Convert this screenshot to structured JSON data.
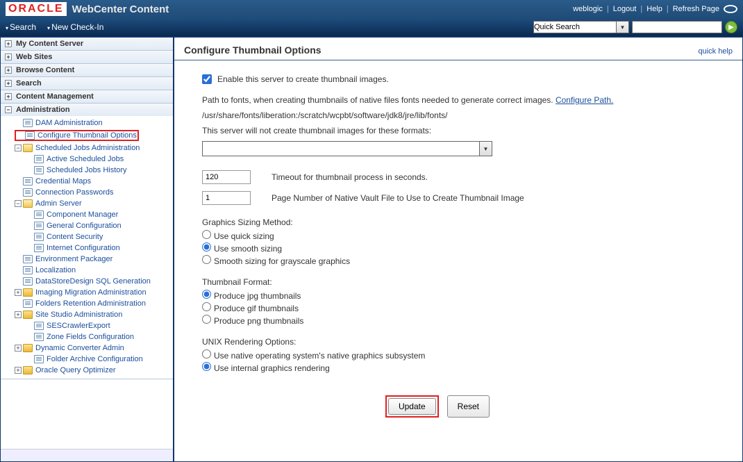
{
  "banner": {
    "logo": "ORACLE",
    "app_title": "WebCenter Content",
    "user": "weblogic",
    "logout": "Logout",
    "help": "Help",
    "refresh": "Refresh Page"
  },
  "menubar": {
    "search": "Search",
    "new_checkin": "New Check-In",
    "quick_search_placeholder": "Quick Search"
  },
  "sidebar": {
    "sections": {
      "my_content": "My Content Server",
      "web_sites": "Web Sites",
      "browse": "Browse Content",
      "search": "Search",
      "content_mgmt": "Content Management",
      "admin": "Administration"
    },
    "tree": {
      "dam_admin": "DAM Administration",
      "config_thumb": "Configure Thumbnail Options",
      "sched_jobs": "Scheduled Jobs Administration",
      "active_jobs": "Active Scheduled Jobs",
      "jobs_hist": "Scheduled Jobs History",
      "cred_maps": "Credential Maps",
      "conn_pw": "Connection Passwords",
      "admin_server": "Admin Server",
      "comp_mgr": "Component Manager",
      "gen_conf": "General Configuration",
      "cont_sec": "Content Security",
      "inet_conf": "Internet Configuration",
      "env_pack": "Environment Packager",
      "loc": "Localization",
      "dsd_sql": "DataStoreDesign SQL Generation",
      "img_mig": "Imaging Migration Administration",
      "fold_ret": "Folders Retention Administration",
      "site_studio": "Site Studio Administration",
      "ses_crawl": "SESCrawlerExport",
      "zone_fields": "Zone Fields Configuration",
      "dyn_conv": "Dynamic Converter Admin",
      "folder_arch": "Folder Archive Configuration",
      "oracle_qo": "Oracle Query Optimizer"
    }
  },
  "main": {
    "title": "Configure Thumbnail Options",
    "quick_help": "quick help",
    "enable_label": "Enable this server to create thumbnail images.",
    "enable_checked": true,
    "path_text_a": "Path to fonts, when creating thumbnails of native files fonts needed to generate correct images. ",
    "configure_path": "Configure Path.",
    "path_value": "/usr/share/fonts/liberation:/scratch/wcpbt/software/jdk8/jre/lib/fonts/",
    "formats_label": "This server will not create thumbnail images for these formats:",
    "timeout_value": "120",
    "timeout_label": "Timeout for thumbnail process in seconds.",
    "page_value": "1",
    "page_label": "Page Number of Native Vault File to Use to Create Thumbnail Image",
    "sizing_title": "Graphics Sizing Method:",
    "sizing_quick": "Use quick sizing",
    "sizing_smooth": "Use smooth sizing",
    "sizing_gray": "Smooth sizing for grayscale graphics",
    "format_title": "Thumbnail Format:",
    "format_jpg": "Produce jpg thumbnails",
    "format_gif": "Produce gif thumbnails",
    "format_png": "Produce png thumbnails",
    "unix_title": "UNIX Rendering Options:",
    "unix_native": "Use native operating system's native graphics subsystem",
    "unix_internal": "Use internal graphics rendering",
    "update_btn": "Update",
    "reset_btn": "Reset"
  }
}
